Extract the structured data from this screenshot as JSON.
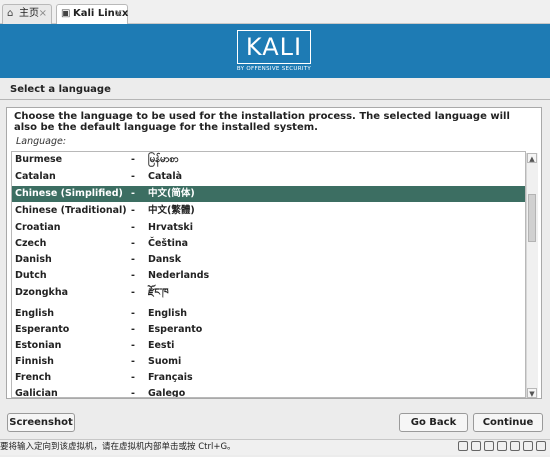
{
  "tabs": [
    {
      "icon": "home-icon",
      "label": "主页"
    },
    {
      "icon": "vm-icon",
      "label": "Kali Linux"
    }
  ],
  "banner": {
    "logo_text": "KALI",
    "logo_sub": "BY OFFENSIVE SECURITY"
  },
  "page": {
    "title": "Select a language",
    "description": "Choose the language to be used for the installation process. The selected language will also be the default language for the installed system.",
    "list_label": "Language:"
  },
  "languages": [
    {
      "name": "Burmese",
      "dash": "-",
      "native": "မြန်မာစာ"
    },
    {
      "name": "Catalan",
      "dash": "-",
      "native": "Català"
    },
    {
      "name": "Chinese (Simplified)",
      "dash": "-",
      "native": "中文(简体)"
    },
    {
      "name": "Chinese (Traditional)",
      "dash": "-",
      "native": "中文(繁體)"
    },
    {
      "name": "Croatian",
      "dash": "-",
      "native": "Hrvatski"
    },
    {
      "name": "Czech",
      "dash": "-",
      "native": "Čeština"
    },
    {
      "name": "Danish",
      "dash": "-",
      "native": "Dansk"
    },
    {
      "name": "Dutch",
      "dash": "-",
      "native": "Nederlands"
    },
    {
      "name": "Dzongkha",
      "dash": "-",
      "native": "རྫོང་ཁ"
    },
    {
      "name": "English",
      "dash": "-",
      "native": "English"
    },
    {
      "name": "Esperanto",
      "dash": "-",
      "native": "Esperanto"
    },
    {
      "name": "Estonian",
      "dash": "-",
      "native": "Eesti"
    },
    {
      "name": "Finnish",
      "dash": "-",
      "native": "Suomi"
    },
    {
      "name": "French",
      "dash": "-",
      "native": "Français"
    },
    {
      "name": "Galician",
      "dash": "-",
      "native": "Galego"
    }
  ],
  "selected_language": "Chinese (Simplified)",
  "buttons": {
    "screenshot": "Screenshot",
    "back": "Go Back",
    "continue": "Continue"
  },
  "status_bar": {
    "text": "要将输入定向到该虚拟机，请在虚拟机内部单击或按 Ctrl+G。"
  },
  "colors": {
    "banner": "#1e7bb4",
    "selection": "#3c6e62"
  }
}
